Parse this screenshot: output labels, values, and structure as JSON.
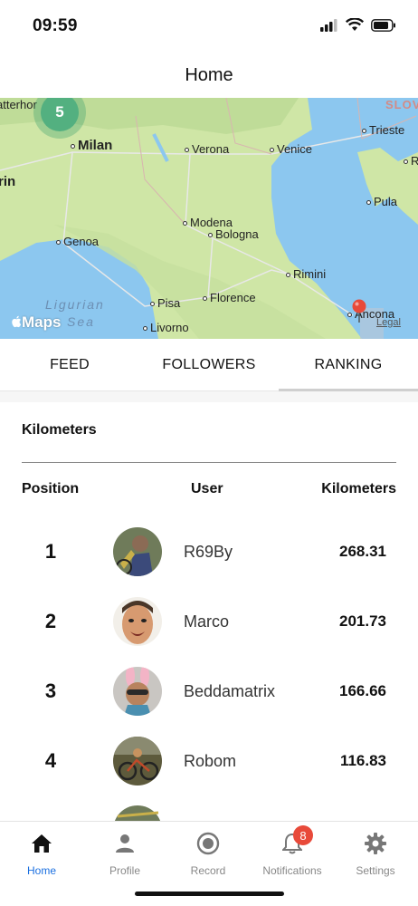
{
  "status_bar": {
    "time": "09:59",
    "icons": [
      "signal-icon",
      "wifi-icon",
      "battery-icon"
    ]
  },
  "header": {
    "title": "Home"
  },
  "map": {
    "cluster_count": "5",
    "cities": {
      "milan": "Milan",
      "verona": "Verona",
      "venice": "Venice",
      "trieste": "Trieste",
      "turin": "rin",
      "modena": "Modena",
      "bologna": "Bologna",
      "genoa": "Genoa",
      "pula": "Pula",
      "rimini": "Rimini",
      "pisa": "Pisa",
      "florence": "Florence",
      "livorno": "Livorno",
      "ancona": "Ancona",
      "zermatt": "atterhor",
      "r_edge": "R"
    },
    "country_label": "SLOV",
    "sea_label_line1": "Ligurian",
    "sea_label_line2": "Sea",
    "maps_logo": "Maps",
    "legal": "Legal"
  },
  "tabs": [
    {
      "label": "FEED",
      "active": false
    },
    {
      "label": "FOLLOWERS",
      "active": false
    },
    {
      "label": "RANKING",
      "active": true
    }
  ],
  "ranking": {
    "title": "Kilometers",
    "columns": {
      "position": "Position",
      "user": "User",
      "kilometers": "Kilometers"
    },
    "rows": [
      {
        "position": "1",
        "user": "R69By",
        "km": "268.31"
      },
      {
        "position": "2",
        "user": "Marco",
        "km": "201.73"
      },
      {
        "position": "3",
        "user": "Beddamatrix",
        "km": "166.66"
      },
      {
        "position": "4",
        "user": "Robom",
        "km": "116.83"
      }
    ]
  },
  "tabbar": {
    "items": [
      {
        "label": "Home",
        "icon": "home-icon",
        "active": true
      },
      {
        "label": "Profile",
        "icon": "person-icon",
        "active": false
      },
      {
        "label": "Record",
        "icon": "record-icon",
        "active": false
      },
      {
        "label": "Notifications",
        "icon": "bell-icon",
        "active": false,
        "badge": "8"
      },
      {
        "label": "Settings",
        "icon": "gear-icon",
        "active": false
      }
    ]
  },
  "colors": {
    "accent": "#1a6fe0",
    "badge": "#e84a3a",
    "cluster": "#53b080",
    "sea": "#8cc7ef",
    "land": "#cfe6a6"
  }
}
